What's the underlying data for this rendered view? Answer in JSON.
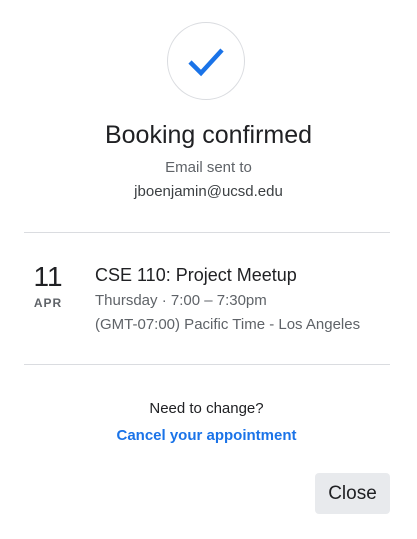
{
  "confirmation": {
    "icon": "checkmark-icon",
    "accent_color": "#1a73e8",
    "title": "Booking confirmed",
    "email_label": "Email sent to",
    "email": "jboenjamin@ucsd.edu"
  },
  "event": {
    "day": "11",
    "month": "APR",
    "title": "CSE 110: Project Meetup",
    "time": "Thursday · 7:00 – 7:30pm",
    "timezone": "(GMT-07:00) Pacific Time - Los Angeles"
  },
  "change": {
    "label": "Need to change?",
    "cancel_link": "Cancel your appointment"
  },
  "actions": {
    "close_label": "Close"
  }
}
